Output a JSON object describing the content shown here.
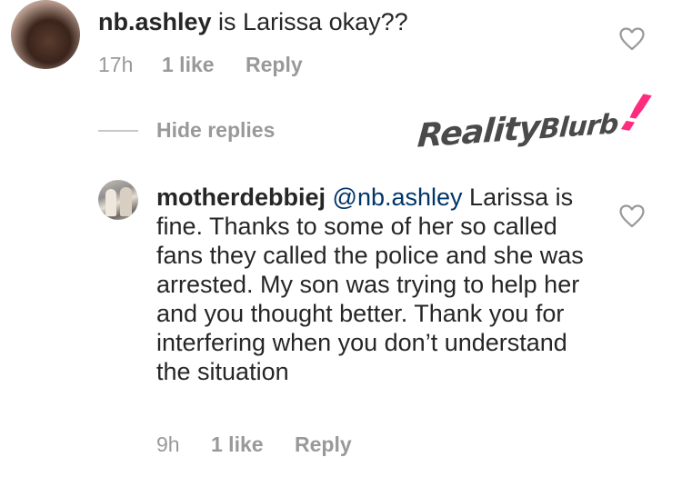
{
  "comments": [
    {
      "username": "nb.ashley",
      "text": " is Larissa okay??",
      "time": "17h",
      "likes": "1 like",
      "reply_label": "Reply"
    },
    {
      "username": "motherdebbiej",
      "mention": "@nb.ashley",
      "text": " Larissa is fine. Thanks to some of her so called fans they called the police and she was arrested. My son was trying to help her and you thought better. Thank you for interfering when you don’t understand the situation",
      "time": "9h",
      "likes": "1 like",
      "reply_label": "Reply"
    }
  ],
  "hide_replies_label": "Hide replies",
  "watermark": {
    "word1": "Reality",
    "word2": "Blurb",
    "mark": "!"
  },
  "icons": {
    "like": "heart-outline-icon"
  },
  "colors": {
    "text": "#262626",
    "secondary": "#999999",
    "mention": "#003569",
    "watermark_accent": "#ff2b7e"
  }
}
